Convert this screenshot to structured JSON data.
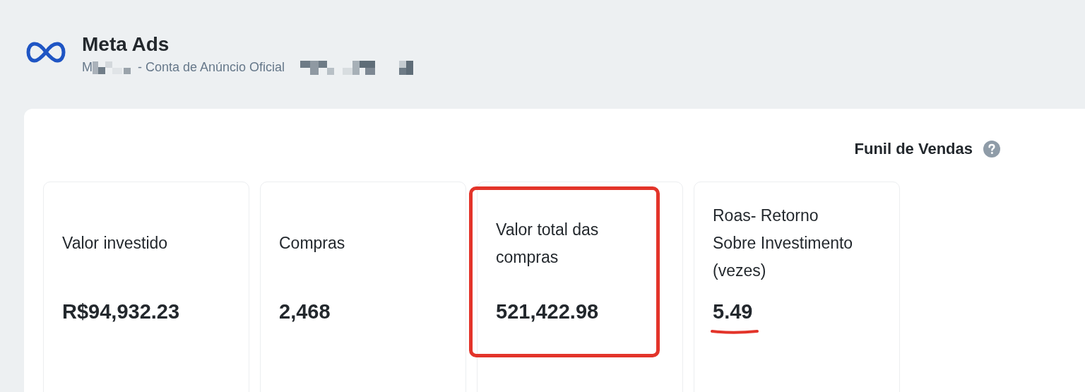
{
  "header": {
    "title": "Meta Ads",
    "subtitle_prefix": "M",
    "subtitle": "- Conta de Anúncio Oficial"
  },
  "section": {
    "title": "Funil de Vendas"
  },
  "cards": [
    {
      "label": "Valor investido",
      "value": "R$94,932.23",
      "boxed": false,
      "underlined": false
    },
    {
      "label": "Compras",
      "value": "2,468",
      "boxed": false,
      "underlined": false
    },
    {
      "label": "Valor total das compras",
      "value": "521,422.98",
      "boxed": true,
      "underlined": false
    },
    {
      "label": "Roas- Retorno Sobre Investimento (vezes)",
      "value": "5.49",
      "boxed": false,
      "underlined": true
    }
  ]
}
